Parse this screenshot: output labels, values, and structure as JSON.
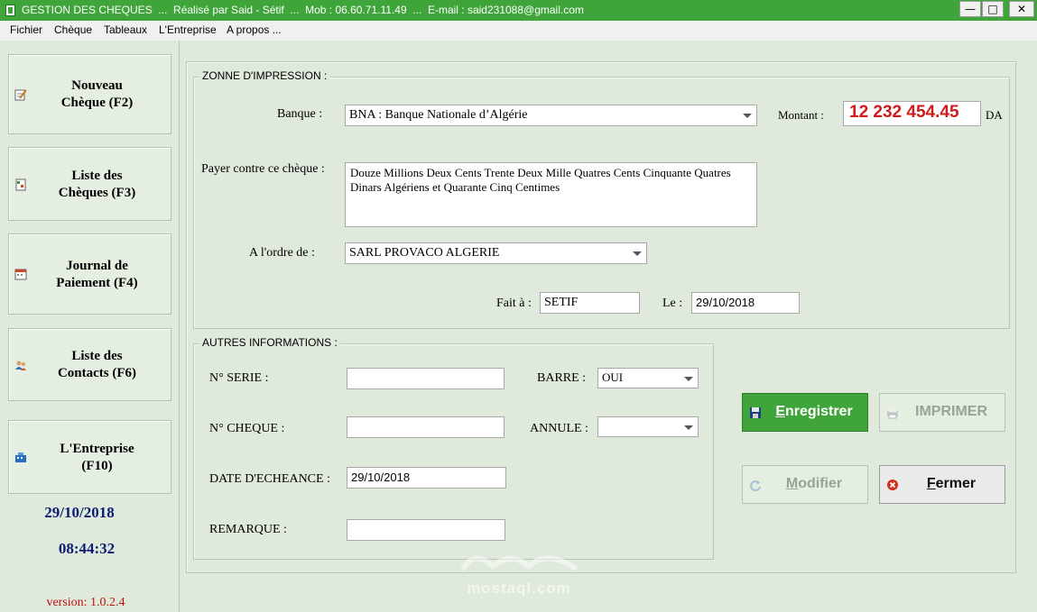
{
  "window": {
    "title": "GESTION DES CHEQUES  ...  Réalisé par Said - Sétif  ...  Mob : 06.60.71.11.49  ...  E-mail : said231088@gmail.com",
    "minimize": "—",
    "maximize": "□",
    "close": "✕"
  },
  "menu": [
    "Fichier",
    "Chèque",
    "Tableaux",
    "L'Entreprise",
    "A propos ..."
  ],
  "sidebar": {
    "buttons": [
      {
        "label": "Nouveau\nChèque (F2)",
        "icon": "edit-cheque-icon"
      },
      {
        "label": "Liste des\nChèques (F3)",
        "icon": "cheque-list-icon"
      },
      {
        "label": "Journal de\nPaiement (F4)",
        "icon": "calendar-journal-icon"
      },
      {
        "label": "Liste des\nContacts (F6)",
        "icon": "contacts-icon"
      },
      {
        "label": "L'Entreprise\n(F10)",
        "icon": "company-icon"
      }
    ],
    "date": "29/10/2018",
    "time": "08:44:32",
    "version": "version: 1.0.2.4"
  },
  "print_zone": {
    "legend": "ZONNE D'IMPRESSION :",
    "banque_label": "Banque :",
    "banque_value": "BNA : Banque Nationale d’Algérie",
    "montant_label": "Montant :",
    "montant_value": "12 232 454.45",
    "currency": "DA",
    "payer_label": "Payer contre ce chèque :",
    "payer_text": "Douze Millions Deux Cents Trente Deux Mille Quatres Cents Cinquante Quatres Dinars Algériens et Quarante Cinq Centimes",
    "ordre_label": "A l'ordre de :",
    "ordre_value": "SARL PROVACO ALGERIE",
    "fait_label": "Fait à :",
    "fait_value": "SETIF",
    "le_label": "Le :",
    "le_value": "29/10/2018"
  },
  "other_info": {
    "legend": "AUTRES INFORMATIONS :",
    "serie_label": "N° SERIE :",
    "serie_value": "",
    "cheque_label": "N° CHEQUE :",
    "cheque_value": "",
    "echeance_label": "DATE D'ECHEANCE :",
    "echeance_value": "29/10/2018",
    "remarque_label": "REMARQUE :",
    "remarque_value": "",
    "barre_label": "BARRE :",
    "barre_value": "OUI",
    "annule_label": "ANNULE :",
    "annule_value": ""
  },
  "actions": {
    "save": "Enregistrer",
    "print": "IMPRIMER",
    "modify": "Modifier",
    "close": "Fermer"
  },
  "watermark": {
    "text": "mostaql.com"
  },
  "colors": {
    "accent_green": "#3fa53a",
    "amount_red": "#d11a1a",
    "clock_blue": "#0b1c72",
    "version_red": "#c01010",
    "background": "#dfeadc"
  }
}
